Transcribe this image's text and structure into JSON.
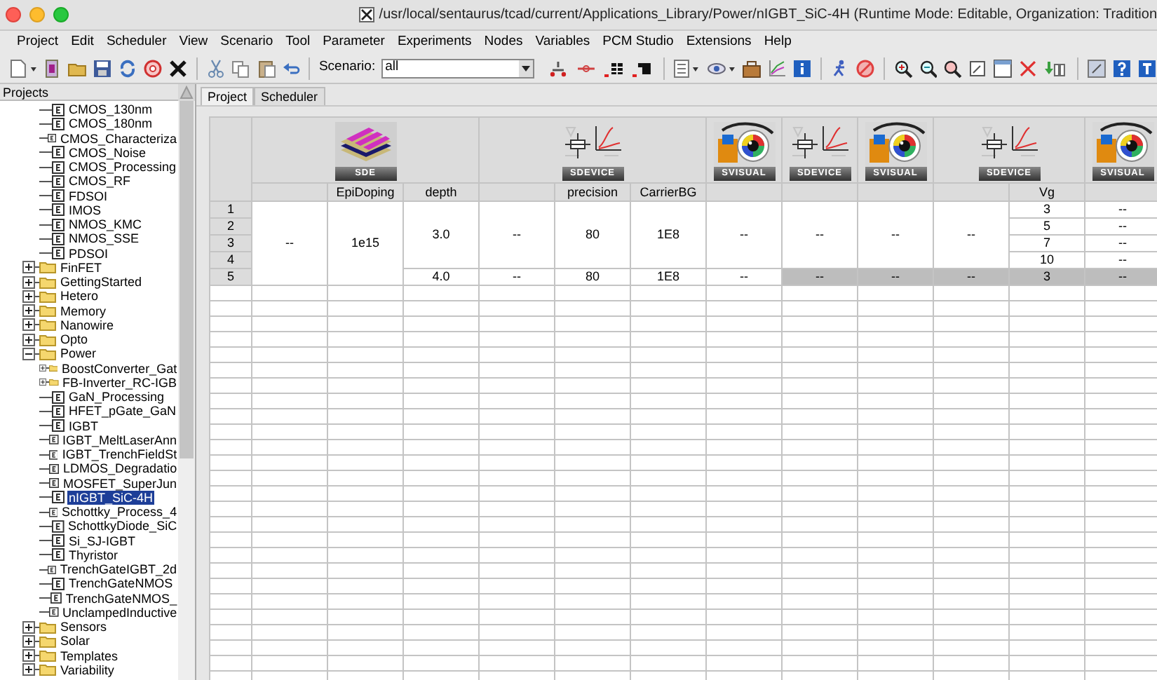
{
  "window": {
    "title": "/usr/local/sentaurus/tcad/current/Applications_Library/Power/nIGBT_SiC-4H (Runtime Mode: Editable, Organization: Tradition"
  },
  "menu": [
    "Project",
    "Edit",
    "Scheduler",
    "View",
    "Scenario",
    "Tool",
    "Parameter",
    "Experiments",
    "Nodes",
    "Variables",
    "PCM Studio",
    "Extensions",
    "Help"
  ],
  "toolbar": {
    "scenario_label": "Scenario:",
    "scenario_value": "all"
  },
  "sidebar": {
    "title": "Projects",
    "tree": [
      {
        "kind": "group",
        "children": [
          {
            "label": "CMOS_130nm",
            "kind": "project",
            "selected": false
          },
          {
            "label": "CMOS_180nm",
            "kind": "project",
            "selected": false
          },
          {
            "label": "CMOS_Characteriza",
            "kind": "project",
            "selected": false
          },
          {
            "label": "CMOS_Noise",
            "kind": "project",
            "selected": false
          },
          {
            "label": "CMOS_Processing",
            "kind": "project",
            "selected": false
          },
          {
            "label": "CMOS_RF",
            "kind": "project",
            "selected": false
          },
          {
            "label": "FDSOI",
            "kind": "project",
            "selected": false
          },
          {
            "label": "IMOS",
            "kind": "project",
            "selected": false
          },
          {
            "label": "NMOS_KMC",
            "kind": "project",
            "selected": false
          },
          {
            "label": "NMOS_SSE",
            "kind": "project",
            "selected": false
          },
          {
            "label": "PDSOI",
            "kind": "project",
            "selected": false
          }
        ]
      },
      {
        "label": "FinFET",
        "kind": "folder",
        "expanded": false,
        "selected": false
      },
      {
        "label": "GettingStarted",
        "kind": "folder",
        "expanded": false,
        "selected": false
      },
      {
        "label": "Hetero",
        "kind": "folder",
        "expanded": false,
        "selected": false
      },
      {
        "label": "Memory",
        "kind": "folder",
        "expanded": false,
        "selected": false
      },
      {
        "label": "Nanowire",
        "kind": "folder",
        "expanded": false,
        "selected": false
      },
      {
        "label": "Opto",
        "kind": "folder",
        "expanded": false,
        "selected": false
      },
      {
        "label": "Power",
        "kind": "folder",
        "expanded": true,
        "selected": false,
        "children": [
          {
            "label": "BoostConverter_Gat",
            "kind": "folder",
            "expanded": false,
            "selected": false
          },
          {
            "label": "FB-Inverter_RC-IGB",
            "kind": "folder",
            "expanded": false,
            "selected": false
          },
          {
            "label": "GaN_Processing",
            "kind": "project",
            "selected": false
          },
          {
            "label": "HFET_pGate_GaN",
            "kind": "project",
            "selected": false
          },
          {
            "label": "IGBT",
            "kind": "project",
            "selected": false
          },
          {
            "label": "IGBT_MeltLaserAnn",
            "kind": "project",
            "selected": false
          },
          {
            "label": "IGBT_TrenchFieldSt",
            "kind": "project",
            "selected": false
          },
          {
            "label": "LDMOS_Degradatio",
            "kind": "project",
            "selected": false
          },
          {
            "label": "MOSFET_SuperJun",
            "kind": "project",
            "selected": false
          },
          {
            "label": "nIGBT_SiC-4H",
            "kind": "project",
            "selected": true
          },
          {
            "label": "Schottky_Process_4",
            "kind": "project",
            "selected": false
          },
          {
            "label": "SchottkyDiode_SiC",
            "kind": "project",
            "selected": false
          },
          {
            "label": "Si_SJ-IGBT",
            "kind": "project",
            "selected": false
          },
          {
            "label": "Thyristor",
            "kind": "project",
            "selected": false
          },
          {
            "label": "TrenchGateIGBT_2d",
            "kind": "project",
            "selected": false
          },
          {
            "label": "TrenchGateNMOS",
            "kind": "project",
            "selected": false
          },
          {
            "label": "TrenchGateNMOS_",
            "kind": "project",
            "selected": false
          },
          {
            "label": "UnclampedInductive",
            "kind": "project",
            "selected": false
          }
        ]
      },
      {
        "label": "Sensors",
        "kind": "folder",
        "expanded": false,
        "selected": false
      },
      {
        "label": "Solar",
        "kind": "folder",
        "expanded": false,
        "selected": false
      },
      {
        "label": "Templates",
        "kind": "folder",
        "expanded": false,
        "selected": false
      },
      {
        "label": "Variability",
        "kind": "folder",
        "expanded": false,
        "selected": false
      }
    ]
  },
  "tabs": [
    {
      "label": "Project",
      "selected": true
    },
    {
      "label": "Scheduler",
      "selected": false
    }
  ],
  "table": {
    "tools": [
      {
        "label": "SDE",
        "kind": "sde",
        "parameters": [
          "EpiDoping",
          "depth"
        ]
      },
      {
        "label": "SDEVICE",
        "kind": "sdevice",
        "parameters": [
          "precision",
          "CarrierBG"
        ]
      },
      {
        "label": "SVISUAL",
        "kind": "svisual"
      },
      {
        "label": "SDEVICE",
        "kind": "sdevice"
      },
      {
        "label": "SVISUAL",
        "kind": "svisual"
      },
      {
        "label": "SDEVICE",
        "kind": "sdevice",
        "parameters": [
          "Vg"
        ]
      },
      {
        "label": "SVISUAL",
        "kind": "svisual"
      }
    ],
    "row_numbers": [
      "1",
      "2",
      "3",
      "4",
      "5"
    ],
    "nodes": [
      {
        "text": "--",
        "highlighted": false,
        "children": [
          {
            "text": "1e15",
            "highlighted": false,
            "children": [
              {
                "text": "3.0",
                "highlighted": false,
                "children": [
                  {
                    "text": "--",
                    "highlighted": false,
                    "children": [
                      {
                        "text": "80",
                        "highlighted": false,
                        "children": [
                          {
                            "text": "1E8",
                            "highlighted": false,
                            "children": [
                              {
                                "text": "--",
                                "highlighted": false,
                                "children": [
                                  {
                                    "text": "--",
                                    "highlighted": false,
                                    "children": [
                                      {
                                        "text": "--",
                                        "highlighted": false,
                                        "children": [
                                          {
                                            "text": "--",
                                            "highlighted": false,
                                            "children": [
                                              {
                                                "text": "3",
                                                "highlighted": false,
                                                "children": [
                                                  {
                                                    "text": "--",
                                                    "highlighted": false
                                                  }
                                                ]
                                              },
                                              {
                                                "text": "5",
                                                "highlighted": false,
                                                "children": [
                                                  {
                                                    "text": "--",
                                                    "highlighted": false
                                                  }
                                                ]
                                              },
                                              {
                                                "text": "7",
                                                "highlighted": false,
                                                "children": [
                                                  {
                                                    "text": "--",
                                                    "highlighted": false
                                                  }
                                                ]
                                              },
                                              {
                                                "text": "10",
                                                "highlighted": false,
                                                "children": [
                                                  {
                                                    "text": "--",
                                                    "highlighted": false
                                                  }
                                                ]
                                              }
                                            ]
                                          }
                                        ]
                                      }
                                    ]
                                  }
                                ]
                              }
                            ]
                          }
                        ]
                      }
                    ]
                  }
                ]
              },
              {
                "text": "4.0",
                "highlighted": false,
                "children": [
                  {
                    "text": "--",
                    "highlighted": false,
                    "children": [
                      {
                        "text": "80",
                        "highlighted": false,
                        "children": [
                          {
                            "text": "1E8",
                            "highlighted": false,
                            "children": [
                              {
                                "text": "--",
                                "highlighted": false,
                                "children": [
                                  {
                                    "text": "--",
                                    "highlighted": true,
                                    "children": [
                                      {
                                        "text": "--",
                                        "highlighted": true,
                                        "children": [
                                          {
                                            "text": "--",
                                            "highlighted": true,
                                            "children": [
                                              {
                                                "text": "3",
                                                "highlighted": true,
                                                "children": [
                                                  {
                                                    "text": "--",
                                                    "highlighted": true
                                                  }
                                                ]
                                              }
                                            ]
                                          }
                                        ]
                                      }
                                    ]
                                  }
                                ]
                              }
                            ]
                          }
                        ]
                      }
                    ]
                  }
                ]
              }
            ]
          }
        ]
      }
    ]
  }
}
